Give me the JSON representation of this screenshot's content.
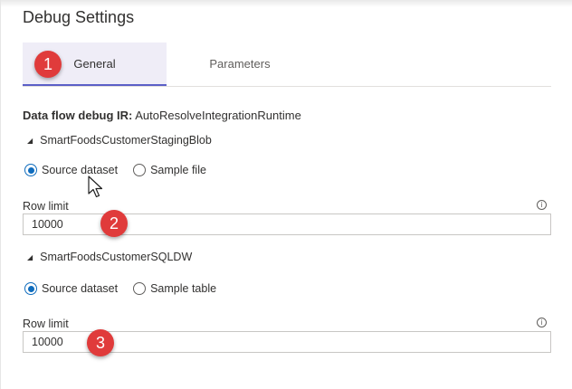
{
  "panel": {
    "title": "Debug Settings"
  },
  "tabs": [
    {
      "label": "General",
      "active": true
    },
    {
      "label": "Parameters",
      "active": false
    }
  ],
  "debug_ir": {
    "label": "Data flow debug IR:",
    "value": "AutoResolveIntegrationRuntime"
  },
  "sources": [
    {
      "name": "SmartFoodsCustomerStagingBlob",
      "options": [
        {
          "label": "Source dataset",
          "selected": true
        },
        {
          "label": "Sample file",
          "selected": false
        }
      ],
      "row_limit_label": "Row limit",
      "row_limit_value": "10000",
      "info_icon": "info-icon"
    },
    {
      "name": "SmartFoodsCustomerSQLDW",
      "options": [
        {
          "label": "Source dataset",
          "selected": true
        },
        {
          "label": "Sample table",
          "selected": false
        }
      ],
      "row_limit_label": "Row limit",
      "row_limit_value": "10000",
      "info_icon": "info-icon"
    }
  ],
  "callouts": [
    "1",
    "2",
    "3"
  ],
  "colors": {
    "accent": "#5b5fc7",
    "radio": "#0f6cbd",
    "callout": "#e03b3b",
    "active_tab_bg": "#efedf7"
  }
}
